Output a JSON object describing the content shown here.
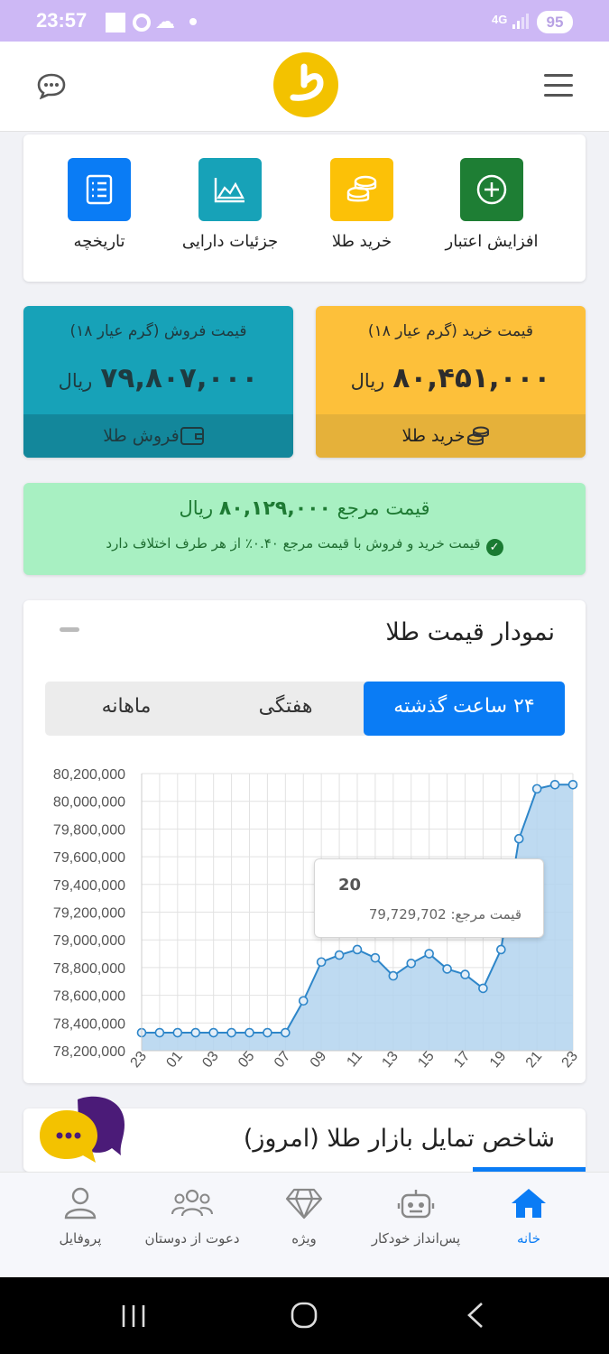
{
  "status_bar": {
    "time": "23:57",
    "network": "4G",
    "battery": "95"
  },
  "header": {
    "menu_icon": "hamburger-icon",
    "logo_icon": "brand-logo",
    "chat_icon": "chat-bubble-icon"
  },
  "actions": [
    {
      "label": "افزایش اعتبار",
      "icon": "plus-circle-icon",
      "color": "#1e7e34"
    },
    {
      "label": "خرید طلا",
      "icon": "coins-icon",
      "color": "#fcc107"
    },
    {
      "label": "جزئیات دارایی",
      "icon": "area-chart-icon",
      "color": "#17a2b8"
    },
    {
      "label": "تاریخچه",
      "icon": "list-icon",
      "color": "#0a7cf5"
    }
  ],
  "buy": {
    "title": "قیمت خرید (گرم عیار ۱۸)",
    "amount": "۸۰,۴۵۱,۰۰۰",
    "unit": "ریال",
    "action": "خرید طلا",
    "color": "#fdc03a"
  },
  "sell": {
    "title": "قیمت فروش (گرم عیار ۱۸)",
    "amount": "۷۹,۸۰۷,۰۰۰",
    "unit": "ریال",
    "action": "فروش طلا",
    "color": "#17a2b8"
  },
  "reference": {
    "label": "قیمت مرجع",
    "amount": "۸۰,۱۲۹,۰۰۰",
    "unit": "ریال",
    "note": "قیمت خرید و فروش با قیمت مرجع ۰.۴۰٪ از هر طرف اختلاف دارد"
  },
  "chart_section": {
    "title": "نمودار قیمت طلا",
    "tabs": [
      {
        "label": "۲۴ ساعت گذشته",
        "active": true
      },
      {
        "label": "هفتگی",
        "active": false
      },
      {
        "label": "ماهانه",
        "active": false
      }
    ],
    "tooltip": {
      "title": "20",
      "series_label": "قیمت مرجع:",
      "value": "79,729,702"
    }
  },
  "chart_data": {
    "type": "area",
    "x": [
      "23",
      "00",
      "01",
      "02",
      "03",
      "04",
      "05",
      "06",
      "07",
      "08",
      "09",
      "10",
      "11",
      "12",
      "13",
      "14",
      "15",
      "16",
      "17",
      "18",
      "19",
      "20",
      "21",
      "22",
      "23"
    ],
    "xtick_labels": [
      "23",
      "01",
      "03",
      "05",
      "07",
      "09",
      "11",
      "13",
      "15",
      "17",
      "19",
      "21",
      "23"
    ],
    "series": [
      {
        "name": "قیمت مرجع",
        "values": [
          78330000,
          78330000,
          78330000,
          78330000,
          78330000,
          78330000,
          78330000,
          78330000,
          78330000,
          78560000,
          78840000,
          78890000,
          78930000,
          78870000,
          78740000,
          78830000,
          78900000,
          78790000,
          78750000,
          78650000,
          78930000,
          79729702,
          80090000,
          80120000,
          80120000
        ]
      }
    ],
    "yticks": [
      "80,200,000",
      "80,000,000",
      "79,800,000",
      "79,600,000",
      "79,400,000",
      "79,200,000",
      "79,000,000",
      "78,800,000",
      "78,600,000",
      "78,400,000",
      "78,200,000"
    ],
    "ylim": [
      78200000,
      80200000
    ],
    "grid": true,
    "line_color": "#2e86c9",
    "fill_color": "#b3d4ef"
  },
  "sentiment": {
    "title": "شاخص تمایل بازار طلا (امروز)"
  },
  "bottom_nav": [
    {
      "label": "خانه",
      "icon": "home-icon",
      "active": true
    },
    {
      "label": "پس‌انداز خودکار",
      "icon": "robot-icon",
      "active": false
    },
    {
      "label": "ویژه",
      "icon": "diamond-icon",
      "active": false
    },
    {
      "label": "دعوت از دوستان",
      "icon": "users-icon",
      "active": false
    },
    {
      "label": "پروفایل",
      "icon": "user-icon",
      "active": false
    }
  ]
}
